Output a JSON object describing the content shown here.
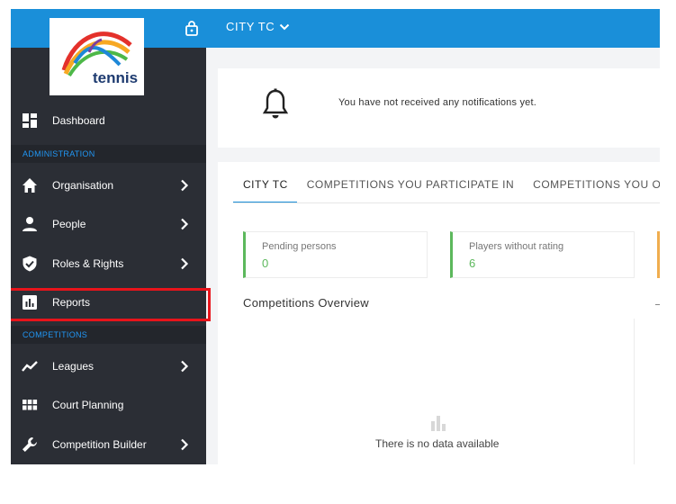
{
  "app": {
    "logo_text": "tennis",
    "org_name": "CITY TC"
  },
  "sidebar": {
    "items": [
      {
        "label": "Dashboard",
        "icon": "dashboard-icon"
      },
      {
        "label": "Organisation",
        "icon": "home-icon"
      },
      {
        "label": "People",
        "icon": "person-icon"
      },
      {
        "label": "Roles & Rights",
        "icon": "shield-check-icon"
      },
      {
        "label": "Reports",
        "icon": "bar-chart-icon"
      },
      {
        "label": "Leagues",
        "icon": "trend-line-icon"
      },
      {
        "label": "Court Planning",
        "icon": "grid-icon"
      },
      {
        "label": "Competition Builder",
        "icon": "wrench-icon"
      }
    ],
    "sections": {
      "administration": "ADMINISTRATION",
      "competitions": "COMPETITIONS"
    }
  },
  "notifications": {
    "message": "You have not received any notifications yet."
  },
  "tabs": [
    {
      "label": "CITY TC"
    },
    {
      "label": "COMPETITIONS YOU PARTICIPATE IN"
    },
    {
      "label": "COMPETITIONS YOU ORGA"
    }
  ],
  "stats": [
    {
      "label": "Pending persons",
      "value": "0"
    },
    {
      "label": "Players without rating",
      "value": "6"
    }
  ],
  "overview": {
    "title": "Competitions Overview",
    "empty_text": "There is no data available"
  },
  "colors": {
    "topbar": "#1a8fd9",
    "sidebar": "#2b2e35",
    "section_header_text": "#2196f3",
    "highlight": "#e8141b",
    "stat_green": "#5cb85c",
    "stat_orange": "#f0ad4e"
  }
}
